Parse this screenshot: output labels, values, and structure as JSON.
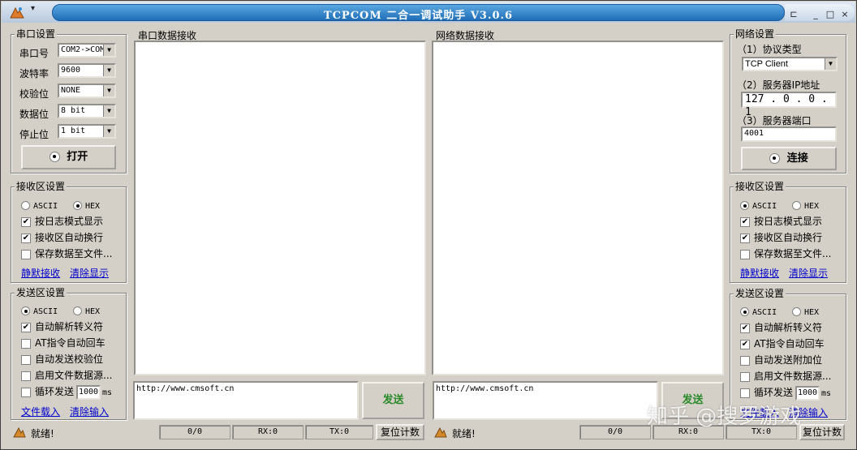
{
  "window": {
    "title": "TCPCOM 二合一调试助手  V3.0.6",
    "menu_arrow": "▾",
    "pin": "⊏",
    "min": "_",
    "max": "□",
    "close": "×"
  },
  "serial_settings": {
    "title": "串口设置",
    "port_label": "串口号",
    "port_value": "COM2->COM",
    "baud_label": "波特率",
    "baud_value": "9600",
    "parity_label": "校验位",
    "parity_value": "NONE",
    "databits_label": "数据位",
    "databits_value": "8 bit",
    "stopbits_label": "停止位",
    "stopbits_value": "1 bit",
    "open_button": "打开"
  },
  "left_recv": {
    "title": "接收区设置",
    "ascii": "ASCII",
    "hex": "HEX",
    "log_mode": "按日志模式显示",
    "auto_wrap": "接收区自动换行",
    "save_file": "保存数据至文件...",
    "mute": "静默接收",
    "clear": "清除显示"
  },
  "left_send": {
    "title": "发送区设置",
    "ascii": "ASCII",
    "hex": "HEX",
    "auto_escape": "自动解析转义符",
    "at_cr": "AT指令自动回车",
    "auto_checksum": "自动发送校验位",
    "file_source": "启用文件数据源...",
    "loop_send": "循环发送",
    "loop_ms_value": "1000",
    "ms": "ms",
    "file_load": "文件载入",
    "clear_input": "清除输入"
  },
  "serial_recv_title": "串口数据接收",
  "net_recv_title": "网络数据接收",
  "serial_send": {
    "text": "http://www.cmsoft.cn",
    "button": "发送"
  },
  "net_send": {
    "text": "http://www.cmsoft.cn",
    "button": "发送"
  },
  "net_settings": {
    "title": "网络设置",
    "protocol_label": "（1）协议类型",
    "protocol_value": "TCP Client",
    "ip_label": "（2）服务器IP地址",
    "ip_value": "127 . 0 . 0 . 1",
    "port_label": "（3）服务器端口",
    "port_value": "4001",
    "connect_button": "连接"
  },
  "right_recv": {
    "title": "接收区设置",
    "ascii": "ASCII",
    "hex": "HEX",
    "log_mode": "按日志模式显示",
    "auto_wrap": "接收区自动换行",
    "save_file": "保存数据至文件...",
    "mute": "静默接收",
    "clear": "清除显示"
  },
  "right_send": {
    "title": "发送区设置",
    "ascii": "ASCII",
    "hex": "HEX",
    "auto_escape": "自动解析转义符",
    "at_cr": "AT指令自动回车",
    "auto_append": "自动发送附加位",
    "file_source": "启用文件数据源...",
    "loop_send": "循环发送",
    "loop_ms_value": "1000",
    "ms": "ms",
    "file_load": "文件载入",
    "clear_input": "清除输入"
  },
  "status_left": {
    "ready": "就绪!",
    "count": "0/0",
    "rx": "RX:0",
    "tx": "TX:0",
    "reset": "复位计数"
  },
  "status_right": {
    "ready": "就绪!",
    "count": "0/0",
    "rx": "RX:0",
    "tx": "TX:0",
    "reset": "复位计数"
  },
  "watermark": "知乎 @搜罗游戏"
}
